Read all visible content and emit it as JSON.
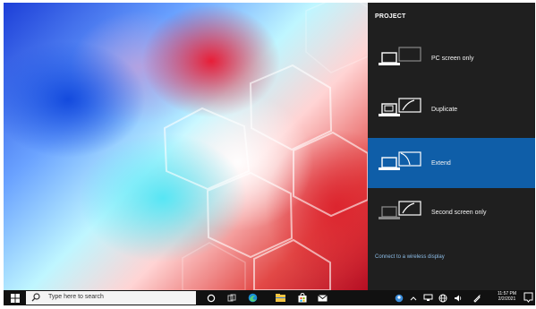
{
  "project_panel": {
    "title": "PROJECT",
    "options": [
      {
        "label": "PC screen only",
        "selected": false,
        "icon": "pc-screen-only-icon"
      },
      {
        "label": "Duplicate",
        "selected": false,
        "icon": "duplicate-icon"
      },
      {
        "label": "Extend",
        "selected": true,
        "icon": "extend-icon"
      },
      {
        "label": "Second screen only",
        "selected": false,
        "icon": "second-screen-only-icon"
      }
    ],
    "wireless_link": "Connect to a wireless display"
  },
  "taskbar": {
    "search_placeholder": "Type here to search",
    "pinned_icons": [
      "cortana-circle-icon",
      "task-view-icon",
      "edge-icon",
      "file-explorer-icon",
      "store-icon",
      "mail-icon"
    ],
    "tray_icons": [
      "user-icon",
      "chevron-up-icon",
      "network-icon",
      "speaker-icon",
      "globe-icon",
      "pen-icon"
    ],
    "clock_time": "11:57 PM",
    "clock_date": "2/2/2021"
  },
  "colors": {
    "panel_bg": "#1f1f1f",
    "selected_bg": "#0f5ea8",
    "link": "#8dbde7",
    "taskbar_bg": "#111111"
  }
}
